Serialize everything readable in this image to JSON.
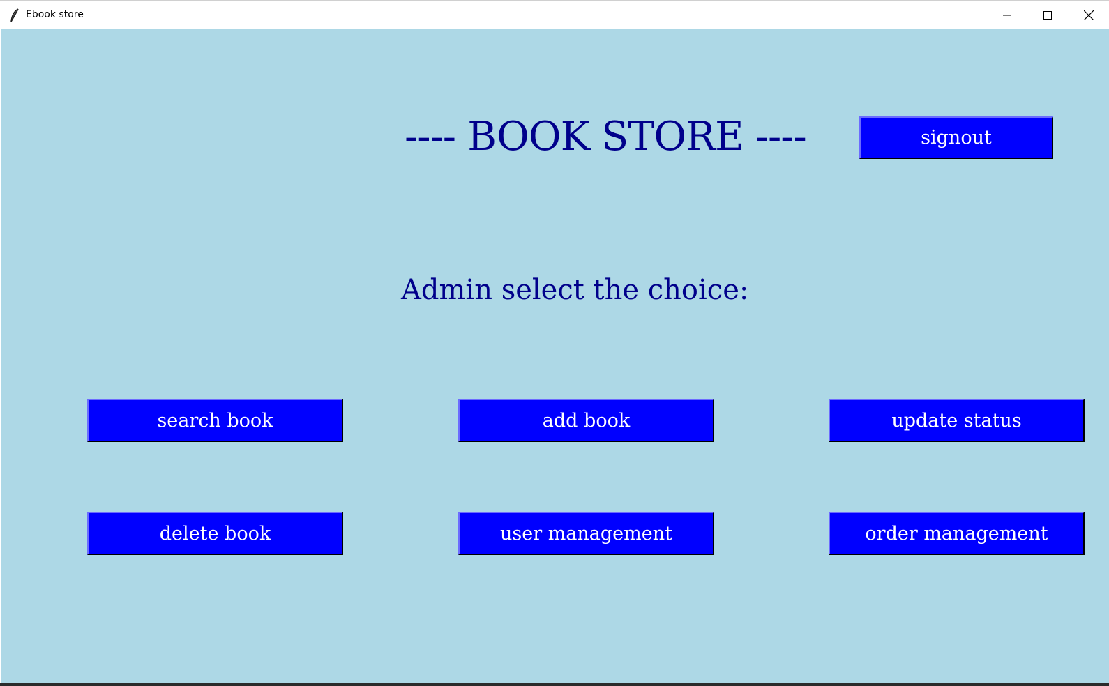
{
  "window": {
    "title": "Ebook store",
    "icon": "feather-icon",
    "controls": [
      "minimize-icon",
      "maximize-icon",
      "close-icon"
    ]
  },
  "colors": {
    "background": "#add8e6",
    "heading_text": "#00008b",
    "button_bg": "#0000ff",
    "button_text": "#ffffff"
  },
  "main": {
    "heading": "---- BOOK STORE ----",
    "subheading": "Admin select the choice:",
    "signout_label": "signout",
    "buttons": {
      "search_book": "search book",
      "add_book": "add book",
      "update_status": "update status",
      "delete_book": "delete book",
      "user_management": "user management",
      "order_management": "order management"
    }
  }
}
